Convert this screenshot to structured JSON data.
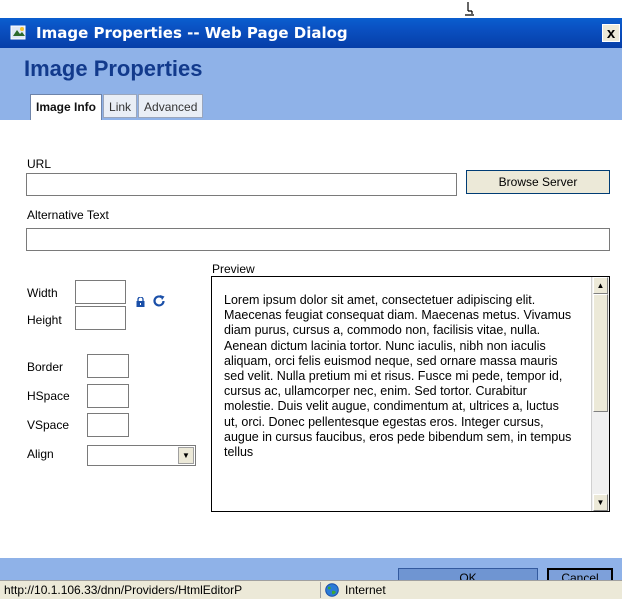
{
  "window": {
    "title": "Image Properties -- Web Page Dialog",
    "close_label": "x"
  },
  "header": {
    "title": "Image Properties",
    "tabs": [
      {
        "label": "Image Info",
        "active": true
      },
      {
        "label": "Link",
        "active": false
      },
      {
        "label": "Advanced",
        "active": false
      }
    ]
  },
  "form": {
    "url_label": "URL",
    "url_value": "",
    "browse_label": "Browse Server",
    "alt_label": "Alternative Text",
    "alt_value": "",
    "width_label": "Width",
    "height_label": "Height",
    "border_label": "Border",
    "hspace_label": "HSpace",
    "vspace_label": "VSpace",
    "align_label": "Align",
    "align_value": ""
  },
  "preview": {
    "label": "Preview",
    "text": "Lorem ipsum dolor sit amet, consectetuer adipiscing elit. Maecenas feugiat consequat diam. Maecenas metus. Vivamus diam purus, cursus a, commodo non, facilisis vitae, nulla. Aenean dictum lacinia tortor. Nunc iaculis, nibh non iaculis aliquam, orci felis euismod neque, sed ornare massa mauris sed velit. Nulla pretium mi et risus. Fusce mi pede, tempor id, cursus ac, ullamcorper nec, enim. Sed tortor. Curabitur molestie. Duis velit augue, condimentum at, ultrices a, luctus ut, orci. Donec pellentesque egestas eros. Integer cursus, augue in cursus faucibus, eros pede bibendum sem, in tempus tellus"
  },
  "footer": {
    "ok_label": "OK",
    "cancel_label": "Cancel"
  },
  "statusbar": {
    "url": "http://10.1.106.33/dnn/Providers/HtmlEditorP",
    "zone": "Internet"
  },
  "icons": {
    "lock": "lock-icon",
    "refresh": "refresh-icon",
    "globe": "globe-icon",
    "app": "ie-icon"
  },
  "colors": {
    "titlebar": "#0a4fc0",
    "header_bg": "#8fb2e8",
    "heading_text": "#123a8c"
  }
}
